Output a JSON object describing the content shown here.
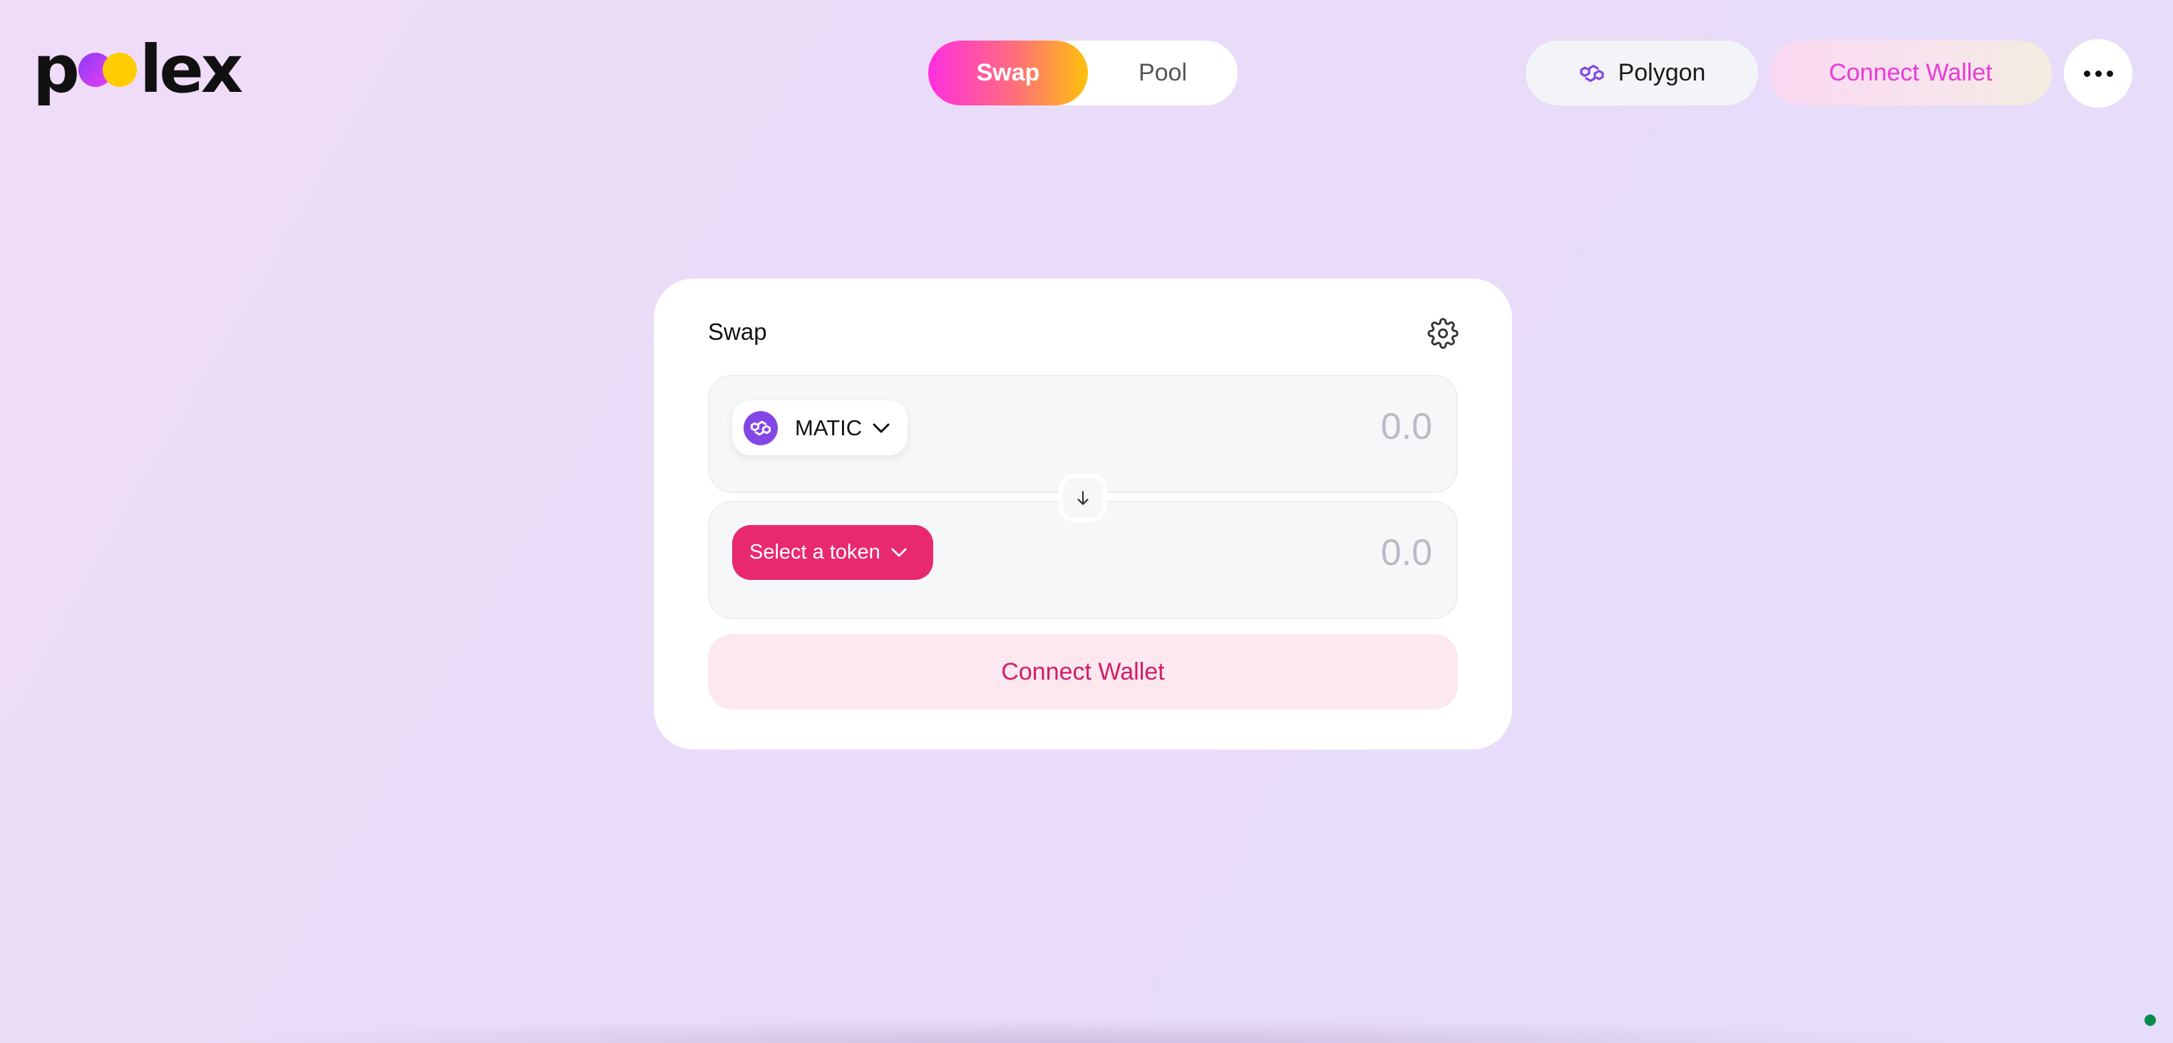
{
  "logo": {
    "text_start": "p",
    "text_end": "lex"
  },
  "nav": {
    "tabs": [
      {
        "label": "Swap",
        "active": true
      },
      {
        "label": "Pool",
        "active": false
      }
    ]
  },
  "header": {
    "network_label": "Polygon",
    "network_icon": "polygon-icon",
    "connect_wallet_label": "Connect Wallet",
    "more_icon": "more-horizontal-icon"
  },
  "swap_card": {
    "title": "Swap",
    "settings_icon": "gear-icon",
    "input": {
      "token_symbol": "MATIC",
      "token_icon": "polygon-icon",
      "amount_placeholder": "0.0"
    },
    "switch_icon": "arrow-down-icon",
    "output": {
      "select_label": "Select a token",
      "amount_placeholder": "0.0"
    },
    "connect_wallet_label": "Connect Wallet"
  },
  "colors": {
    "accent_pink": "#e9296f",
    "brand_gradient_start": "#ff2ee0",
    "brand_gradient_end": "#ffc20a",
    "polygon_purple": "#8247e5",
    "status_green": "#0a8a4a"
  }
}
